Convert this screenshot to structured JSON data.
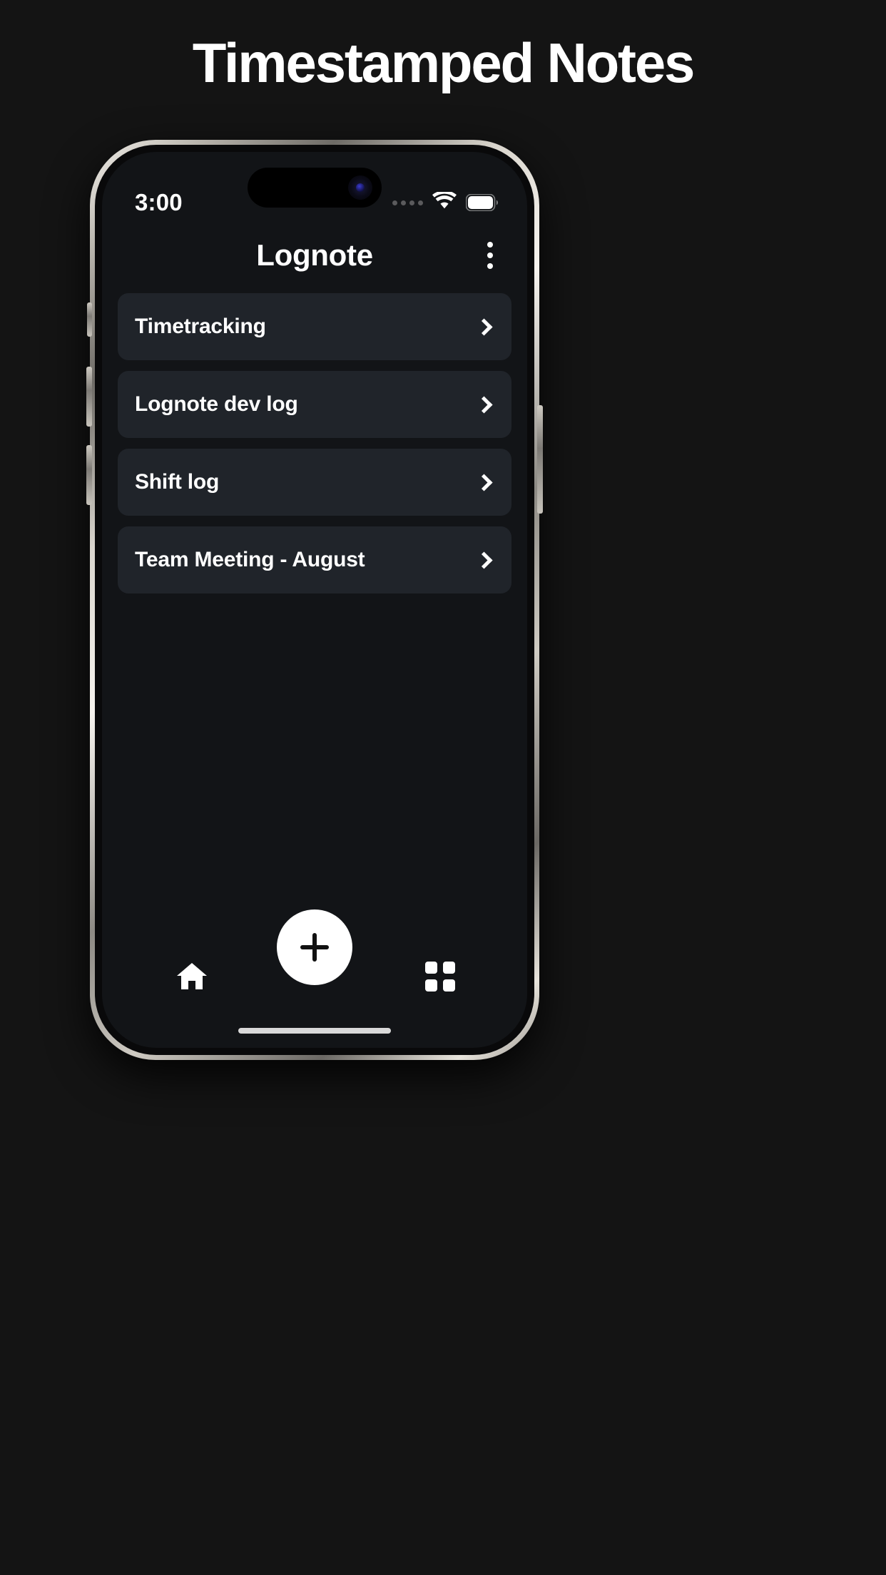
{
  "banner": {
    "title": "Timestamped Notes",
    "background_color": "#141414",
    "title_color": "#ffffff"
  },
  "phone": {
    "frame_color": "#cfcbc3",
    "screen_background": "#121417",
    "status_bar": {
      "time": "3:00",
      "signal_icon": "signal-dots-icon",
      "wifi_icon": "wifi-icon",
      "battery_icon": "battery-full-icon"
    },
    "dynamic_island": {
      "camera_icon": "front-camera-icon"
    }
  },
  "app": {
    "header": {
      "title": "Lognote",
      "overflow_icon": "more-vertical-icon"
    },
    "notes": [
      {
        "title": "Timetracking",
        "chevron": "chevron-right-icon"
      },
      {
        "title": "Lognote dev log",
        "chevron": "chevron-right-icon"
      },
      {
        "title": "Shift log",
        "chevron": "chevron-right-icon"
      },
      {
        "title": "Team Meeting - August",
        "chevron": "chevron-right-icon"
      }
    ],
    "card_background": "#20242a",
    "bottom_bar": {
      "home_icon": "home-icon",
      "add_icon": "plus-icon",
      "grid_icon": "grid-icon",
      "fab_color": "#ffffff"
    }
  }
}
